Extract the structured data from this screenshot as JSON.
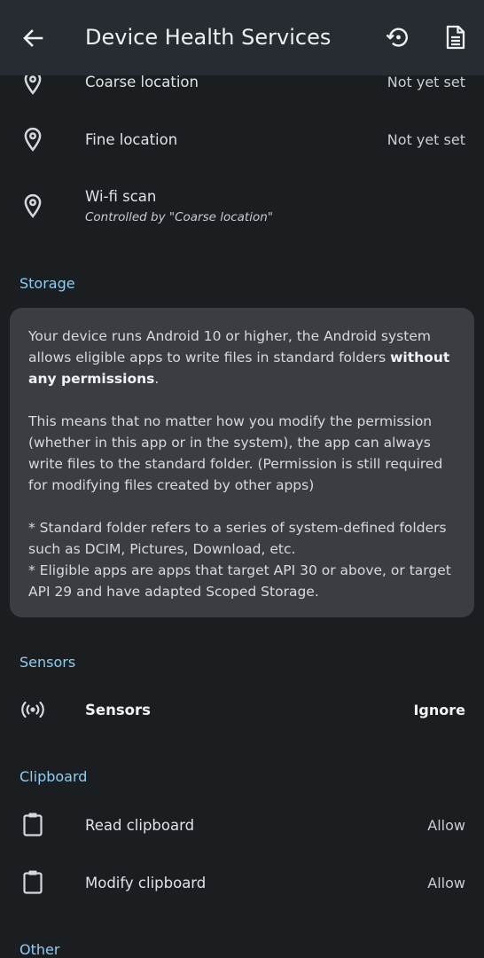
{
  "header": {
    "title": "Device Health Services"
  },
  "location": {
    "items": [
      {
        "label": "Coarse location",
        "value": "Not yet set"
      },
      {
        "label": "Fine location",
        "value": "Not yet set"
      },
      {
        "label": "Wi-fi scan",
        "sub": "Controlled by \"Coarse location\""
      }
    ]
  },
  "storage": {
    "header": "Storage",
    "p1a": "Your device runs Android 10 or higher, the Android system allows eligible apps to write files in standard folders ",
    "p1b": "without any permissions",
    "p1c": ".",
    "p2": "This means that no matter how you modify the permission (whether in this app or in the system), the app can always write files to the standard folder. (Permission is still required for modifying files created by other apps)",
    "p3": "* Standard folder refers to a series of system-defined folders such as DCIM, Pictures, Download, etc.",
    "p4": "* Eligible apps are apps that target API 30 or above, or target API 29 and have adapted Scoped Storage."
  },
  "sensors": {
    "header": "Sensors",
    "label": "Sensors",
    "value": "Ignore"
  },
  "clipboard": {
    "header": "Clipboard",
    "items": [
      {
        "label": "Read clipboard",
        "value": "Allow"
      },
      {
        "label": "Modify clipboard",
        "value": "Allow"
      }
    ]
  },
  "other": {
    "header": "Other"
  },
  "icons": {
    "back": "arrow-back-icon",
    "reset": "history-icon",
    "doc": "document-icon",
    "location": "location-pin-icon",
    "sensors": "sensors-icon",
    "clipboard": "clipboard-icon"
  },
  "colors": {
    "background": "#1b1e21",
    "appbar": "#262c31",
    "card": "#3a3e43",
    "accent": "#8fcdf2"
  }
}
